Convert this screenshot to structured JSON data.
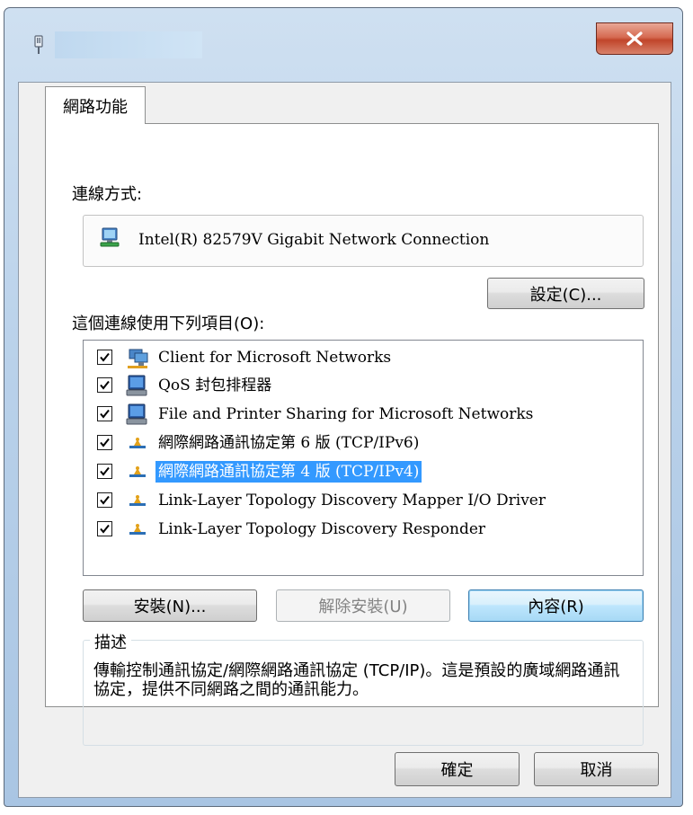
{
  "dialog": {
    "tab_label": "網路功能",
    "connect_using_label": "連線方式:",
    "adapter_name": "Intel(R) 82579V Gigabit Network Connection",
    "configure_label": "設定(C)...",
    "items_label": "這個連線使用下列項目(O):",
    "items": [
      {
        "label": "Client for Microsoft Networks",
        "checked": true,
        "icon": "network-client-icon",
        "selected": false
      },
      {
        "label": "QoS 封包排程器",
        "checked": true,
        "icon": "service-computer-icon",
        "selected": false
      },
      {
        "label": "File and Printer Sharing for Microsoft Networks",
        "checked": true,
        "icon": "service-computer-icon",
        "selected": false
      },
      {
        "label": "網際網路通訊協定第 6 版 (TCP/IPv6)",
        "checked": true,
        "icon": "protocol-icon",
        "selected": false
      },
      {
        "label": "網際網路通訊協定第 4 版 (TCP/IPv4)",
        "checked": true,
        "icon": "protocol-icon",
        "selected": true
      },
      {
        "label": "Link-Layer Topology Discovery Mapper I/O Driver",
        "checked": true,
        "icon": "protocol-icon",
        "selected": false
      },
      {
        "label": "Link-Layer Topology Discovery Responder",
        "checked": true,
        "icon": "protocol-icon",
        "selected": false
      }
    ],
    "install_label": "安裝(N)...",
    "uninstall_label": "解除安裝(U)",
    "properties_label": "內容(R)",
    "description_title": "描述",
    "description_text": "傳輸控制通訊協定/網際網路通訊協定 (TCP/IP)。這是預設的廣域網路通訊協定，提供不同網路之間的通訊能力。",
    "ok_label": "確定",
    "cancel_label": "取消"
  },
  "colors": {
    "selection": "#3399ff",
    "close_button": "#c1452a",
    "window_frame": "#b9d1ea"
  }
}
